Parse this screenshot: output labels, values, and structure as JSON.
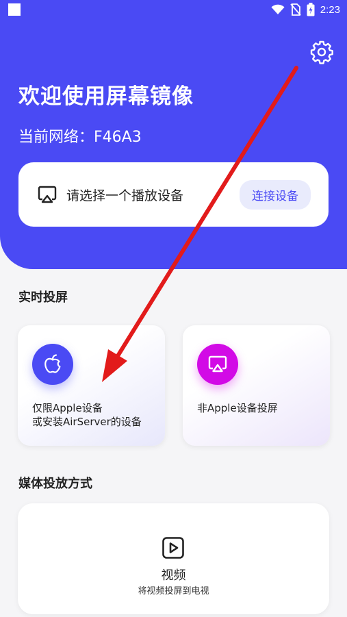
{
  "status_bar": {
    "time": "2:23",
    "icons": [
      "notification-square-icon",
      "wifi-icon",
      "no-sim-icon",
      "battery-charging-icon"
    ]
  },
  "header": {
    "welcome": "欢迎使用屏幕镜像",
    "network": "当前网络：F46A3",
    "device_hint": "请选择一个播放设备",
    "connect_label": "连接设备",
    "accent_color": "#4a4af4"
  },
  "realtime": {
    "title": "实时投屏",
    "apple_line1": "仅限Apple设备",
    "apple_line2": "或安装AirServer的设备",
    "other_label": "非Apple设备投屏"
  },
  "media": {
    "title": "媒体投放方式",
    "video_title": "视频",
    "video_sub": "将视频投屏到电视"
  }
}
